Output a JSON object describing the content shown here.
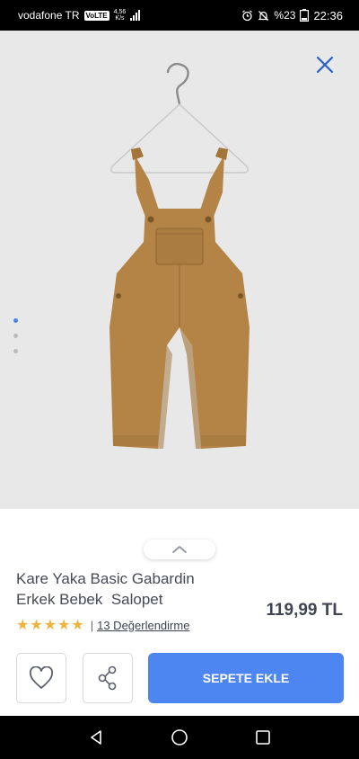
{
  "status_bar": {
    "carrier": "vodafone TR",
    "volte": "VoLTE",
    "net_speed": "4,56",
    "net_unit": "K/s",
    "battery": "%23",
    "time": "22:36"
  },
  "gallery": {
    "slide_count": 3,
    "active_slide": 1
  },
  "product": {
    "title_line1": "Kare Yaka Basic Gabardin",
    "title_line2": "Erkek Bebek  Salopet",
    "price": "119,99 TL",
    "rating_stars": "★★★★★",
    "rating_value": 5,
    "separator": "|",
    "reviews_text": "13 Değerlendirme"
  },
  "actions": {
    "add_to_cart_label": "SEPETE EKLE"
  },
  "colors": {
    "accent": "#4d86f0",
    "star": "#f0b43c",
    "product": "#b38446"
  }
}
